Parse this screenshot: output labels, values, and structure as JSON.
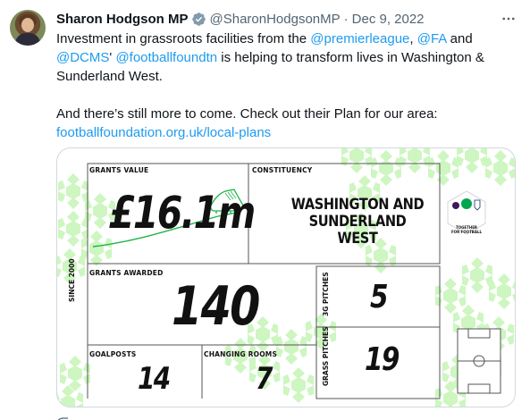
{
  "author": {
    "name": "Sharon Hodgson MP",
    "handle": "@SharonHodgsonMP",
    "separator": "·",
    "date": "Dec 9, 2022"
  },
  "more_icon": "more-horizontal-icon",
  "verified_icon": "verified-badge-icon",
  "tweet": {
    "l1_a": "Investment in grassroots facilities from the ",
    "l1_mention1": "@premierleague",
    "l1_b": ", ",
    "l1_mention2": "@FA",
    "l1_c": " and",
    "l2_mention3": "@DCMS",
    "l2_a": "' ",
    "l2_mention4": "@footballfoundtn",
    "l2_b": " is helping to transform lives in Washington &",
    "l3": "Sunderland West.",
    "l4": "And there’s still more to come. Check out their Plan for our area:",
    "l5_link": "footballfoundation.org.uk/local-plans"
  },
  "infographic": {
    "side_label": "SINCE 2000",
    "grants_value_label": "GRANTS VALUE",
    "grants_value": "£16.1m",
    "constituency_label": "CONSTITUENCY",
    "constituency_line1": "WASHINGTON AND",
    "constituency_line2": "SUNDERLAND WEST",
    "grants_awarded_label": "GRANTS AWARDED",
    "grants_awarded": "140",
    "pitches_3g_label": "3G PITCHES",
    "pitches_3g": "5",
    "grass_pitches_label": "GRASS PITCHES",
    "grass_pitches": "19",
    "goalposts_label": "GOALPOSTS",
    "goalposts": "14",
    "changing_rooms_label": "CHANGING ROOMS",
    "changing_rooms": "7",
    "badge_line1": "TOGETHER",
    "badge_line2": "FOR FOOTBALL",
    "badge_center": "FOOTBALL FOUNDATION",
    "colors": {
      "accent_green": "#c8f5b8",
      "grid_line": "#555555",
      "link": "#1d9bf0",
      "muted": "#536471",
      "ff_green": "#00a651"
    }
  }
}
